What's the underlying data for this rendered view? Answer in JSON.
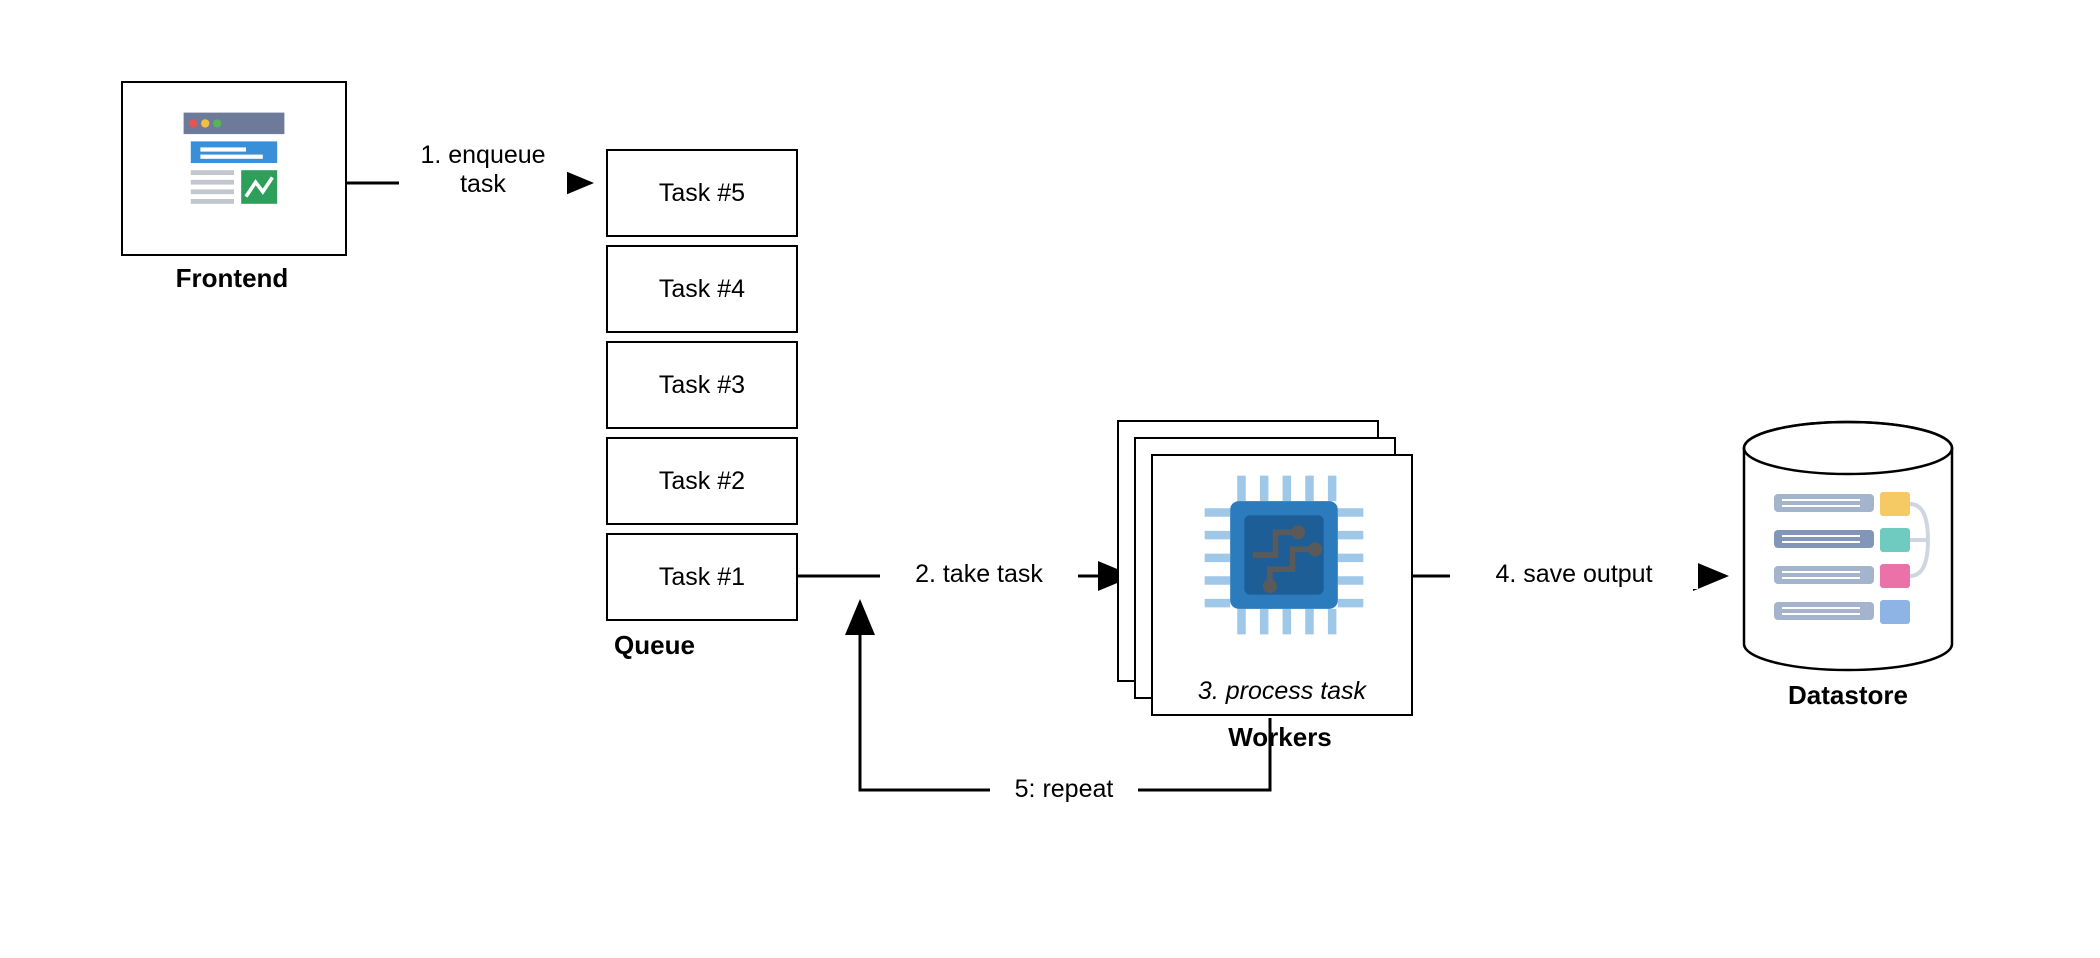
{
  "nodes": {
    "frontend": {
      "label": "Frontend"
    },
    "queue": {
      "label": "Queue",
      "tasks": [
        "Task #5",
        "Task #4",
        "Task #3",
        "Task #2",
        "Task #1"
      ]
    },
    "workers": {
      "label": "Workers",
      "inner_caption": "3. process task"
    },
    "datastore": {
      "label": "Datastore"
    }
  },
  "edges": {
    "enqueue": {
      "label_line1": "1. enqueue",
      "label_line2": "task"
    },
    "take": {
      "label": "2. take task"
    },
    "save": {
      "label": "4. save output"
    },
    "repeat": {
      "label": "5: repeat"
    }
  }
}
